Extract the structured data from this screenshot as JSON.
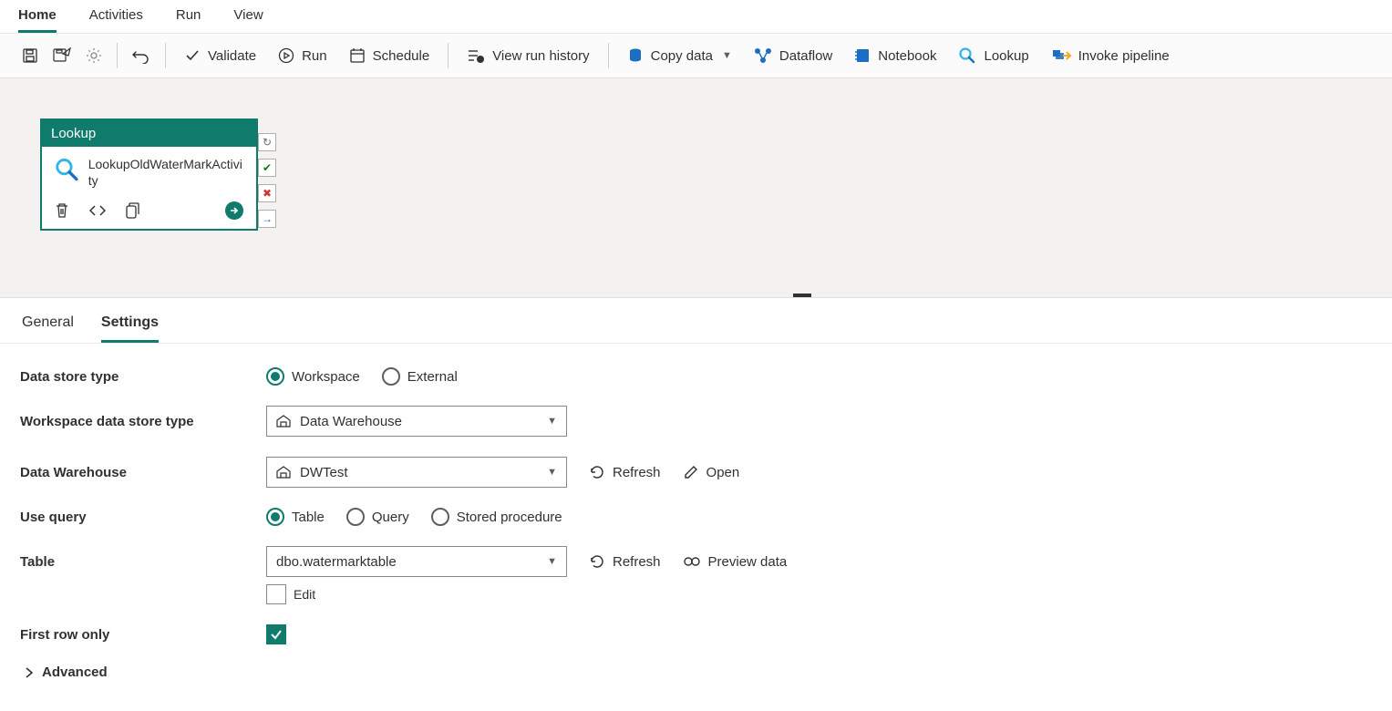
{
  "topTabs": {
    "home": "Home",
    "activities": "Activities",
    "run": "Run",
    "view": "View"
  },
  "toolbar": {
    "validate": "Validate",
    "run": "Run",
    "schedule": "Schedule",
    "viewRunHistory": "View run history",
    "copyData": "Copy data",
    "dataflow": "Dataflow",
    "notebook": "Notebook",
    "lookup": "Lookup",
    "invokePipeline": "Invoke pipeline"
  },
  "node": {
    "type": "Lookup",
    "name": "LookupOldWaterMarkActivity"
  },
  "panelTabs": {
    "general": "General",
    "settings": "Settings"
  },
  "labels": {
    "dataStoreType": "Data store type",
    "workspaceDataStoreType": "Workspace data store type",
    "dataWarehouse": "Data Warehouse",
    "useQuery": "Use query",
    "table": "Table",
    "firstRowOnly": "First row only",
    "advanced": "Advanced",
    "edit": "Edit",
    "refresh": "Refresh",
    "open": "Open",
    "previewData": "Preview data"
  },
  "radios": {
    "workspace": "Workspace",
    "external": "External",
    "table": "Table",
    "query": "Query",
    "storedProcedure": "Stored procedure"
  },
  "values": {
    "workspaceDataStoreType": "Data Warehouse",
    "dataWarehouse": "DWTest",
    "table": "dbo.watermarktable"
  }
}
